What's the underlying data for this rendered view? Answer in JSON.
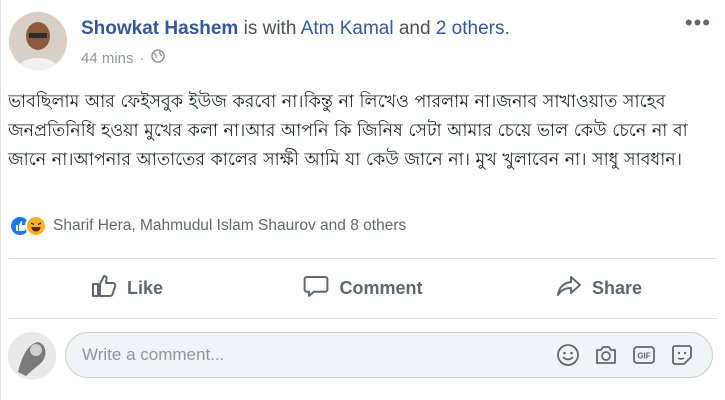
{
  "post": {
    "author": "Showkat Hashem",
    "with_text": "is with",
    "tagged": "Atm Kamal",
    "and_text": "and",
    "others": "2 others.",
    "time": "44 mins",
    "separator": "·",
    "privacy_icon": "globe-icon",
    "text": "ভাবছিলাম আর ফেইসবুক ইউজ করবো না।কিন্তু না লিখেও পারলাম না।জনাব সাখাওয়াত সাহেব জনপ্রতিনিধি হওয়া মুখের কলা না।আর আপনি কি জিনিষ সেটা আমার চেয়ে ভাল কেউ চেনে না বা জানে না।আপনার আতাতের কালের সাক্ষী আমি যা কেউ জানে না। মুখ খুলাবেন না। সাধু সাবধান।"
  },
  "reactions": {
    "icons": [
      "like-reaction-icon",
      "haha-reaction-icon"
    ],
    "summary": "Sharif Hera, Mahmudul Islam Shaurov and 8 others"
  },
  "actions": {
    "like": "Like",
    "comment": "Comment",
    "share": "Share"
  },
  "comment_input": {
    "placeholder": "Write a comment...",
    "icons": [
      "emoji-icon",
      "camera-icon",
      "gif-icon",
      "sticker-icon"
    ]
  },
  "colors": {
    "link": "#365899",
    "muted": "#606770",
    "like_blue": "#1877f2",
    "haha_yellow": "#f7b125"
  }
}
